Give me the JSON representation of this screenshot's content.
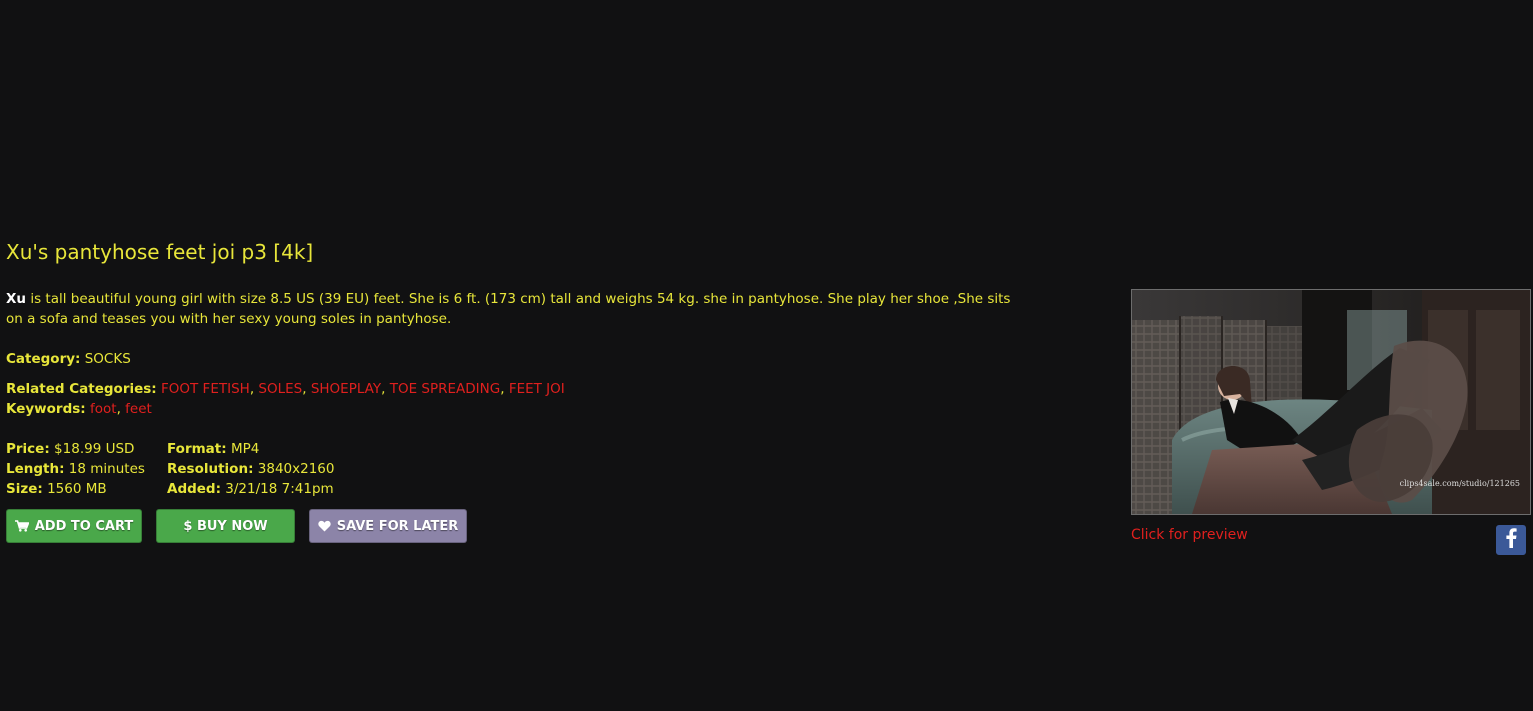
{
  "clip": {
    "title": "Xu's pantyhose feet joi p3 [4k]",
    "model_name": "Xu",
    "description_rest": " is tall beautiful young girl with size 8.5 US (39 EU) feet. She is 6 ft. (173 cm) tall and weighs 54 kg. she in pantyhose. She play her shoe ,She sits on a sofa and teases you with her sexy young soles in pantyhose."
  },
  "category": {
    "label": "Category:",
    "value": "SOCKS"
  },
  "related": {
    "label": "Related Categories:",
    "items": [
      "FOOT FETISH",
      "SOLES",
      "SHOEPLAY",
      "TOE SPREADING",
      "FEET JOI"
    ]
  },
  "keywords": {
    "label": "Keywords:",
    "items": [
      "foot",
      "feet"
    ]
  },
  "specs": {
    "price_label": "Price:",
    "price_value": "$18.99 USD",
    "length_label": "Length:",
    "length_value": "18 minutes",
    "size_label": "Size:",
    "size_value": "1560 MB",
    "format_label": "Format:",
    "format_value": "MP4",
    "resolution_label": "Resolution:",
    "resolution_value": "3840x2160",
    "added_label": "Added:",
    "added_value": "3/21/18 7:41pm"
  },
  "buttons": {
    "add_to_cart": "ADD TO CART",
    "buy_now": "$ BUY NOW",
    "save_for_later": "SAVE FOR LATER"
  },
  "preview": {
    "watermark": "clips4sale.com/studio/121265",
    "link_text": "Click for preview"
  },
  "icons": {
    "cart": "cart-icon",
    "heart": "heart-icon",
    "facebook": "facebook-icon"
  },
  "colors": {
    "background": "#111112",
    "text": "#e8e63a",
    "link": "#e0201e",
    "button_green": "#4aa84a",
    "button_purple": "#8c84a8",
    "facebook": "#3b5998"
  }
}
